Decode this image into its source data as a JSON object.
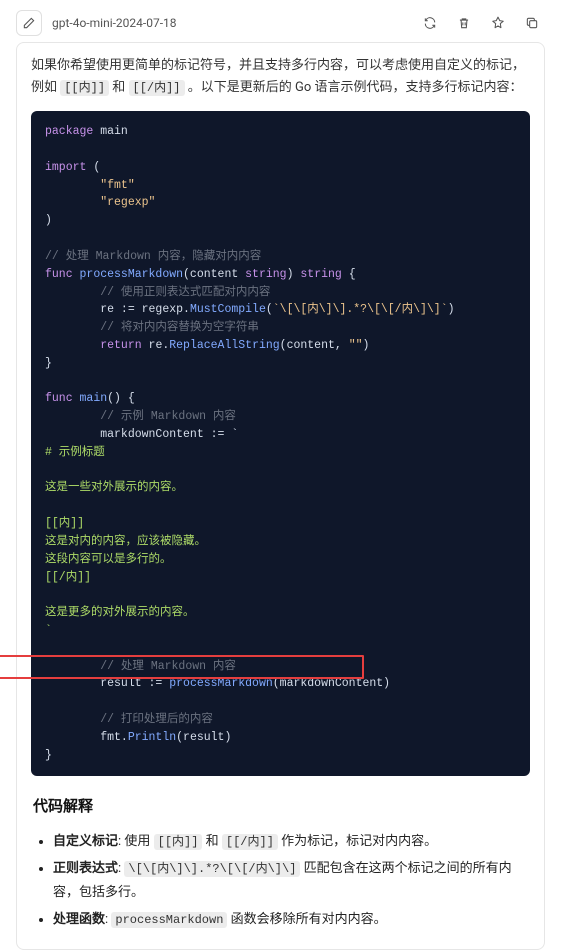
{
  "header": {
    "model": "gpt-4o-mini-2024-07-18"
  },
  "intro": {
    "t1": "如果你希望使用更简单的标记符号，并且支持多行内容，可以考虑使用自定义的标记，例如 ",
    "code1": "[[内]]",
    "t2": " 和 ",
    "code2": "[[/内]]",
    "t3": " 。以下是更新后的 Go 语言示例代码，支持多行标记内容："
  },
  "code": {
    "l1_k": "package",
    "l1_p": " main",
    "l3_k": "import",
    "l3_p": " (",
    "l4": "\"fmt\"",
    "l5": "\"regexp\"",
    "l6": ")",
    "l8": "// 处理 Markdown 内容，隐藏对内内容",
    "l9_k": "func",
    "l9_fn": " processMarkdown",
    "l9_p1": "(content ",
    "l9_t1": "string",
    "l9_p2": ") ",
    "l9_t2": "string",
    "l9_p3": " {",
    "l10": "// 使用正则表达式匹配对内内容",
    "l11_a": "re := regexp.",
    "l11_fn": "MustCompile",
    "l11_p1": "(",
    "l11_s": "`\\[\\[内\\]\\].*?\\[\\[/内\\]\\]`",
    "l11_p2": ")",
    "l12": "// 将对内内容替换为空字符串",
    "l13_k": "return",
    "l13_a": " re.",
    "l13_fn": "ReplaceAllString",
    "l13_p1": "(content, ",
    "l13_s": "\"\"",
    "l13_p2": ")",
    "l14": "}",
    "l16_k": "func",
    "l16_fn": " main",
    "l16_p": "() {",
    "l17": "// 示例 Markdown 内容",
    "l18": "markdownContent := `",
    "l19": "# 示例标题",
    "l21": "这是一些对外展示的内容。",
    "l23": "[[内]]",
    "l24": "这是对内的内容，应该被隐藏。",
    "l25": "这段内容可以是多行的。",
    "l26": "[[/内]]",
    "l28": "这是更多的对外展示的内容。",
    "l29": "`",
    "l31": "// 处理 Markdown 内容",
    "l32_a": "result := ",
    "l32_fn": "processMarkdown",
    "l32_p": "(markdownContent)",
    "l34": "// 打印处理后的内容",
    "l35_a": "fmt.",
    "l35_fn": "Println",
    "l35_p": "(result)",
    "l36": "}"
  },
  "explain": {
    "title": "代码解释",
    "li1_b": "自定义标记",
    "li1_t1": ": 使用 ",
    "li1_c1": "[[内]]",
    "li1_t2": " 和 ",
    "li1_c2": "[[/内]]",
    "li1_t3": " 作为标记，标记对内内容。",
    "li2_b": "正则表达式",
    "li2_t1": ": ",
    "li2_c1": "\\[\\[内\\]\\].*?\\[\\[/内\\]\\]",
    "li2_t2": " 匹配包含在这两个标记之间的所有内容，包括多行。",
    "li3_b": "处理函数",
    "li3_t1": ": ",
    "li3_c1": "processMarkdown",
    "li3_t2": " 函数会移除所有对内内容。"
  }
}
